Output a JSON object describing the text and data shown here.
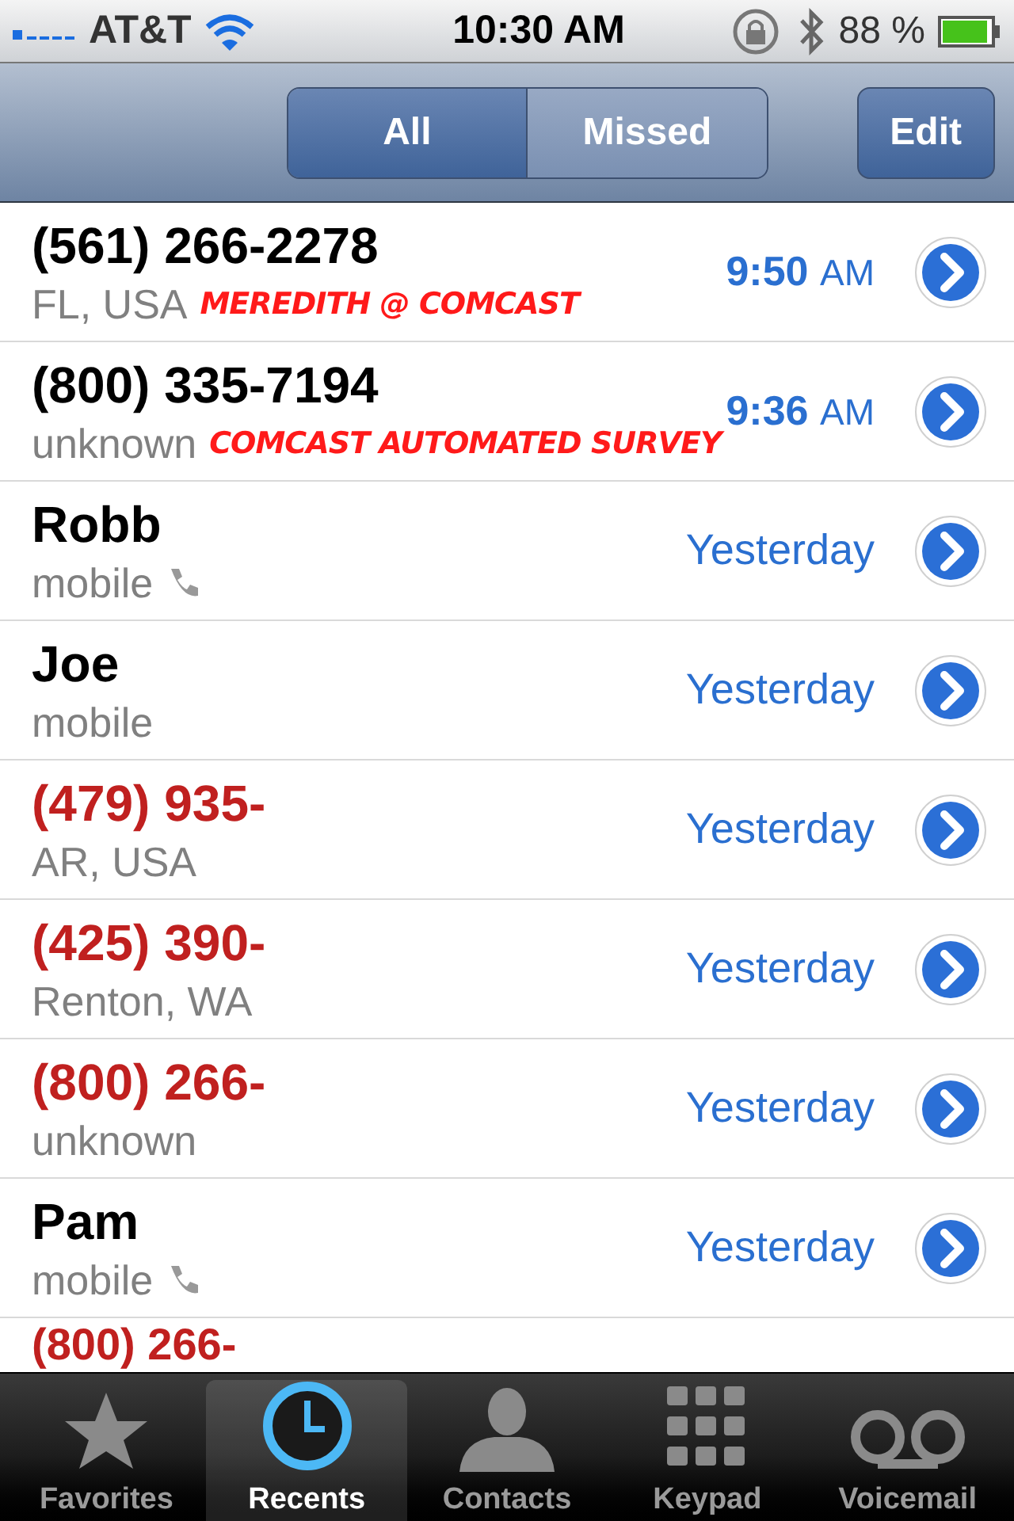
{
  "status_bar": {
    "carrier": "AT&T",
    "time": "10:30 AM",
    "battery": "88 %"
  },
  "segments": [
    {
      "label": "All",
      "selected": true
    },
    {
      "label": "Missed",
      "selected": false
    }
  ],
  "edit_button": "Edit",
  "calls": [
    {
      "name": "(561) 266-2278",
      "detail": "FL, USA",
      "note": "MEREDITH @ COMCAST",
      "time": "9:50",
      "period": "AM",
      "missed": false,
      "phone_icon": false
    },
    {
      "name": "(800) 335-7194",
      "detail": "unknown",
      "note": "COMCAST AUTOMATED SURVEY",
      "time": "9:36",
      "period": "AM",
      "missed": false,
      "phone_icon": false
    },
    {
      "name": "Robb",
      "detail": "mobile",
      "date": "Yesterday",
      "missed": false,
      "phone_icon": true
    },
    {
      "name": "Joe",
      "detail": "mobile",
      "date": "Yesterday",
      "missed": false,
      "phone_icon": false
    },
    {
      "name": "(479) 935-",
      "detail": "AR, USA",
      "date": "Yesterday",
      "missed": true,
      "phone_icon": false
    },
    {
      "name": "(425) 390-",
      "detail": "Renton, WA",
      "date": "Yesterday",
      "missed": true,
      "phone_icon": false
    },
    {
      "name": "(800) 266-",
      "detail": "unknown",
      "date": "Yesterday",
      "missed": true,
      "phone_icon": false
    },
    {
      "name": "Pam",
      "detail": "mobile",
      "date": "Yesterday",
      "missed": false,
      "phone_icon": true
    }
  ],
  "partial_call": {
    "name": "(800) 266-",
    "missed": true
  },
  "tabs": [
    {
      "label": "Favorites",
      "kind": "star",
      "selected": false
    },
    {
      "label": "Recents",
      "kind": "clock",
      "selected": true
    },
    {
      "label": "Contacts",
      "kind": "person",
      "selected": false
    },
    {
      "label": "Keypad",
      "kind": "keypad",
      "selected": false
    },
    {
      "label": "Voicemail",
      "kind": "voicemail",
      "selected": false
    }
  ]
}
